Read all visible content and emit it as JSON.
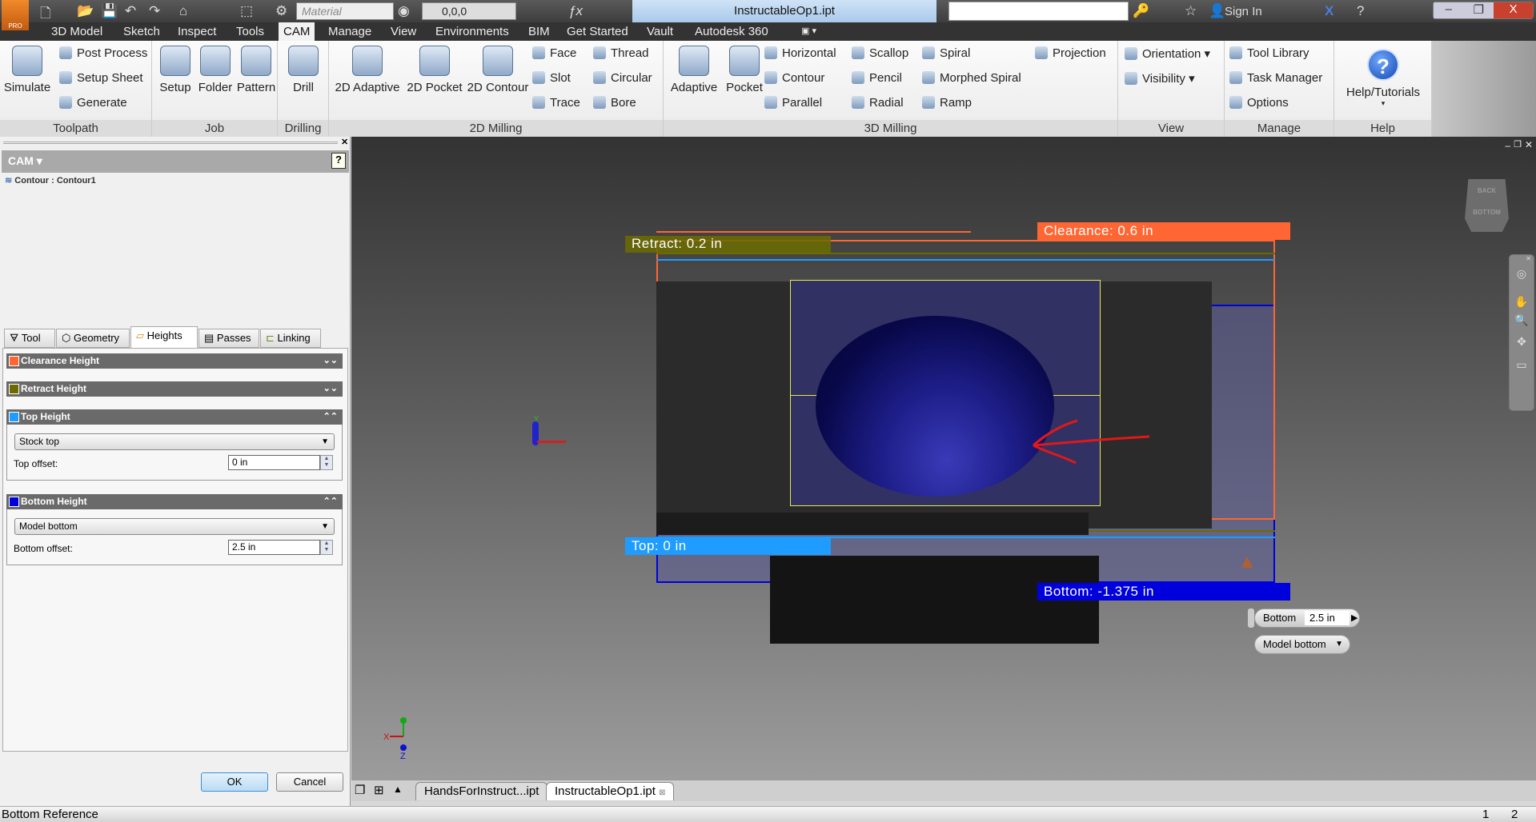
{
  "app": {
    "logo_badge": "PRO",
    "document_title": "InstructableOp1.ipt",
    "material_placeholder": "Material",
    "appearance_value": "0,0,0",
    "sign_in": "Sign In"
  },
  "ribbon_tabs": [
    "3D Model",
    "Sketch",
    "Inspect",
    "Tools",
    "CAM",
    "Manage",
    "View",
    "Environments",
    "BIM",
    "Get Started",
    "Vault",
    "Autodesk 360"
  ],
  "active_tab": "CAM",
  "ribbon": {
    "toolpath": {
      "label": "Toolpath",
      "simulate": "Simulate",
      "post_process": "Post Process",
      "setup_sheet": "Setup Sheet",
      "generate": "Generate"
    },
    "job": {
      "label": "Job",
      "setup": "Setup",
      "folder": "Folder",
      "pattern": "Pattern"
    },
    "drilling": {
      "label": "Drilling",
      "drill": "Drill"
    },
    "milling2d": {
      "label": "2D Milling",
      "adaptive": "2D Adaptive",
      "pocket": "2D Pocket",
      "contour": "2D Contour",
      "face": "Face",
      "slot": "Slot",
      "trace": "Trace",
      "thread": "Thread",
      "circular": "Circular",
      "bore": "Bore"
    },
    "milling3d": {
      "label": "3D Milling",
      "adaptive": "Adaptive",
      "pocket": "Pocket",
      "horizontal": "Horizontal",
      "contour": "Contour",
      "parallel": "Parallel",
      "scallop": "Scallop",
      "pencil": "Pencil",
      "radial": "Radial",
      "spiral": "Spiral",
      "morphed_spiral": "Morphed Spiral",
      "ramp": "Ramp",
      "projection": "Projection"
    },
    "view": {
      "label": "View",
      "orientation": "Orientation",
      "visibility": "Visibility"
    },
    "manage": {
      "label": "Manage",
      "tool_library": "Tool Library",
      "task_manager": "Task Manager",
      "options": "Options"
    },
    "help": {
      "label": "Help",
      "help_tutorials": "Help/Tutorials"
    }
  },
  "panel": {
    "title": "CAM",
    "operation": "Contour : Contour1",
    "tabs": [
      "Tool",
      "Geometry",
      "Heights",
      "Passes",
      "Linking"
    ],
    "active_tab": "Heights",
    "sections": {
      "clearance": {
        "title": "Clearance Height",
        "color": "#ff6633"
      },
      "retract": {
        "title": "Retract Height",
        "color": "#6b6b00"
      },
      "top": {
        "title": "Top Height",
        "color": "#1e9cff",
        "reference": "Stock top",
        "offset_label": "Top offset:",
        "offset_value": "0 in"
      },
      "bottom": {
        "title": "Bottom Height",
        "color": "#0000dd",
        "reference": "Model bottom",
        "offset_label": "Bottom offset:",
        "offset_value": "2.5 in"
      }
    },
    "ok": "OK",
    "cancel": "Cancel"
  },
  "viewport": {
    "clearance_label": "Clearance: 0.6 in",
    "retract_label": "Retract: 0.2 in",
    "top_label": "Top: 0 in",
    "bottom_label": "Bottom: -1.375 in",
    "viewcube_back": "BACK",
    "viewcube_bottom": "BOTTOM",
    "inline_ref": "Bottom",
    "inline_value": "2.5 in",
    "inline_dropdown": "Model bottom",
    "axis_x": "X",
    "axis_y": "Y",
    "axis_z": "Z"
  },
  "doc_tabs": [
    "HandsForInstruct...ipt",
    "InstructableOp1.ipt"
  ],
  "status": {
    "text": "Bottom Reference",
    "count1": "1",
    "count2": "2"
  }
}
